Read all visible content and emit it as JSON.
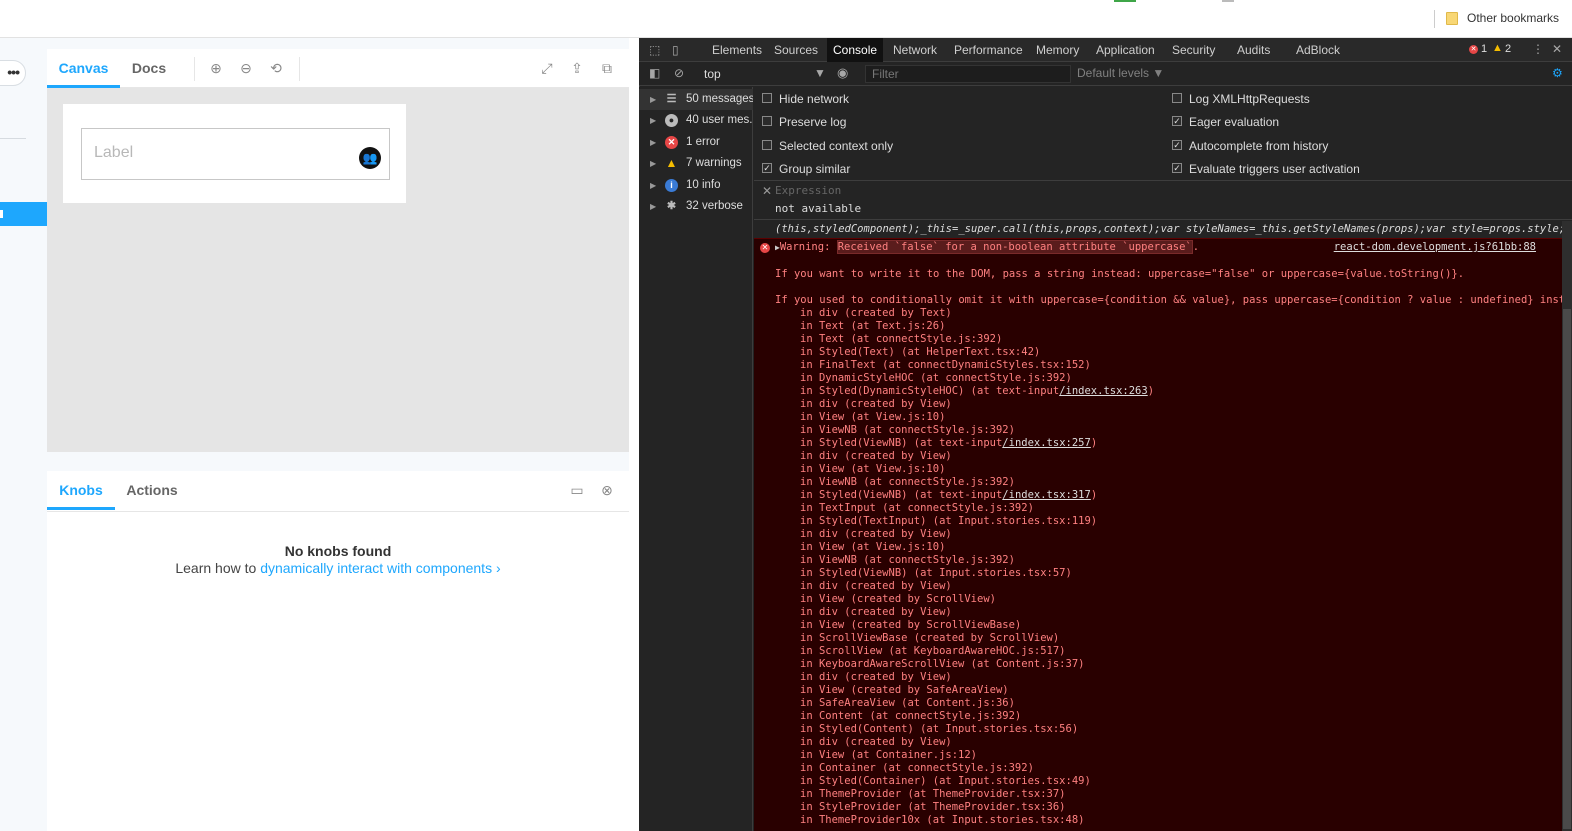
{
  "bookmarks": {
    "other_bookmarks": "Other bookmarks"
  },
  "storybook": {
    "nav_more": "•••",
    "toolbar": {
      "tab_canvas": "Canvas",
      "tab_docs": "Docs"
    },
    "preview": {
      "input_placeholder": "Label"
    },
    "addons": {
      "tab_knobs": "Knobs",
      "tab_actions": "Actions",
      "empty_title": "No knobs found",
      "empty_text": "Learn how to ",
      "empty_link": "dynamically interact with components",
      "empty_link_arrow": "›"
    }
  },
  "devtools": {
    "tabs": [
      "Elements",
      "Sources",
      "Console",
      "Network",
      "Performance",
      "Memory",
      "Application",
      "Security",
      "Audits",
      "AdBlock"
    ],
    "active_tab": "Console",
    "error_count": "1",
    "warning_count": "2",
    "context": "top",
    "filter_placeholder": "Filter",
    "levels": "Default levels ▼",
    "sidebar": [
      {
        "label": "50 messages",
        "icon": "list-icon"
      },
      {
        "label": "40 user mes...",
        "icon": "user-icon"
      },
      {
        "label": "1 error",
        "icon": "error-icon"
      },
      {
        "label": "7 warnings",
        "icon": "warning-icon"
      },
      {
        "label": "10 info",
        "icon": "info-icon"
      },
      {
        "label": "32 verbose",
        "icon": "bug-icon"
      }
    ],
    "settings": {
      "hide_network": "Hide network",
      "preserve_log": "Preserve log",
      "selected_context_only": "Selected context only",
      "group_similar": "Group similar",
      "log_xhr": "Log XMLHttpRequests",
      "eager_evaluation": "Eager evaluation",
      "autocomplete_history": "Autocomplete from history",
      "evaluate_triggers": "Evaluate triggers user activation"
    },
    "expression": {
      "placeholder": "Expression",
      "value": "not available"
    },
    "prev_line": "(this,styledComponent);_this=_super.call(this,props,context);var styleNames=_this.getStyleNames(props);var style=props.style;va…",
    "error": {
      "prefix": "Warning: ",
      "highlight": "Received `false` for a non-boolean attribute `uppercase`",
      "suffix": ".",
      "source": "react-dom.development.js?61bb:88",
      "para1": "If you want to write it to the DOM, pass a string instead: uppercase=\"false\" or uppercase={value.toString()}.",
      "para2": "If you used to conditionally omit it with uppercase={condition && value}, pass uppercase={condition ? value : undefined} instead.",
      "stack": [
        {
          "t": "in div (created by Text)"
        },
        {
          "t": "in Text (at Text.js:26)"
        },
        {
          "t": "in Text (at connectStyle.js:392)"
        },
        {
          "t": "in Styled(Text) (at HelperText.tsx:42)"
        },
        {
          "t": "in FinalText (at connectDynamicStyles.tsx:152)"
        },
        {
          "t": "in DynamicStyleHOC (at connectStyle.js:392)"
        },
        {
          "t": "in Styled(DynamicStyleHOC) (at text-input",
          "u": "/index.tsx:263",
          "e": ")"
        },
        {
          "t": "in div (created by View)"
        },
        {
          "t": "in View (at View.js:10)"
        },
        {
          "t": "in ViewNB (at connectStyle.js:392)"
        },
        {
          "t": "in Styled(ViewNB) (at text-input",
          "u": "/index.tsx:257",
          "e": ")"
        },
        {
          "t": "in div (created by View)"
        },
        {
          "t": "in View (at View.js:10)"
        },
        {
          "t": "in ViewNB (at connectStyle.js:392)"
        },
        {
          "t": "in Styled(ViewNB) (at text-input",
          "u": "/index.tsx:317",
          "e": ")"
        },
        {
          "t": "in TextInput (at connectStyle.js:392)"
        },
        {
          "t": "in Styled(TextInput) (at Input.stories.tsx:119)"
        },
        {
          "t": "in div (created by View)"
        },
        {
          "t": "in View (at View.js:10)"
        },
        {
          "t": "in ViewNB (at connectStyle.js:392)"
        },
        {
          "t": "in Styled(ViewNB) (at Input.stories.tsx:57)"
        },
        {
          "t": "in div (created by View)"
        },
        {
          "t": "in View (created by ScrollView)"
        },
        {
          "t": "in div (created by View)"
        },
        {
          "t": "in View (created by ScrollViewBase)"
        },
        {
          "t": "in ScrollViewBase (created by ScrollView)"
        },
        {
          "t": "in ScrollView (at KeyboardAwareHOC.js:517)"
        },
        {
          "t": "in KeyboardAwareScrollView (at Content.js:37)"
        },
        {
          "t": "in div (created by View)"
        },
        {
          "t": "in View (created by SafeAreaView)"
        },
        {
          "t": "in SafeAreaView (at Content.js:36)"
        },
        {
          "t": "in Content (at connectStyle.js:392)"
        },
        {
          "t": "in Styled(Content) (at Input.stories.tsx:56)"
        },
        {
          "t": "in div (created by View)"
        },
        {
          "t": "in View (at Container.js:12)"
        },
        {
          "t": "in Container (at connectStyle.js:392)"
        },
        {
          "t": "in Styled(Container) (at Input.stories.tsx:49)"
        },
        {
          "t": "in ThemeProvider (at ThemeProvider.tsx:37)"
        },
        {
          "t": "in StyleProvider (at ThemeProvider.tsx:36)"
        },
        {
          "t": "in ThemeProvider10x (at Input.stories.tsx:48)"
        }
      ]
    }
  }
}
